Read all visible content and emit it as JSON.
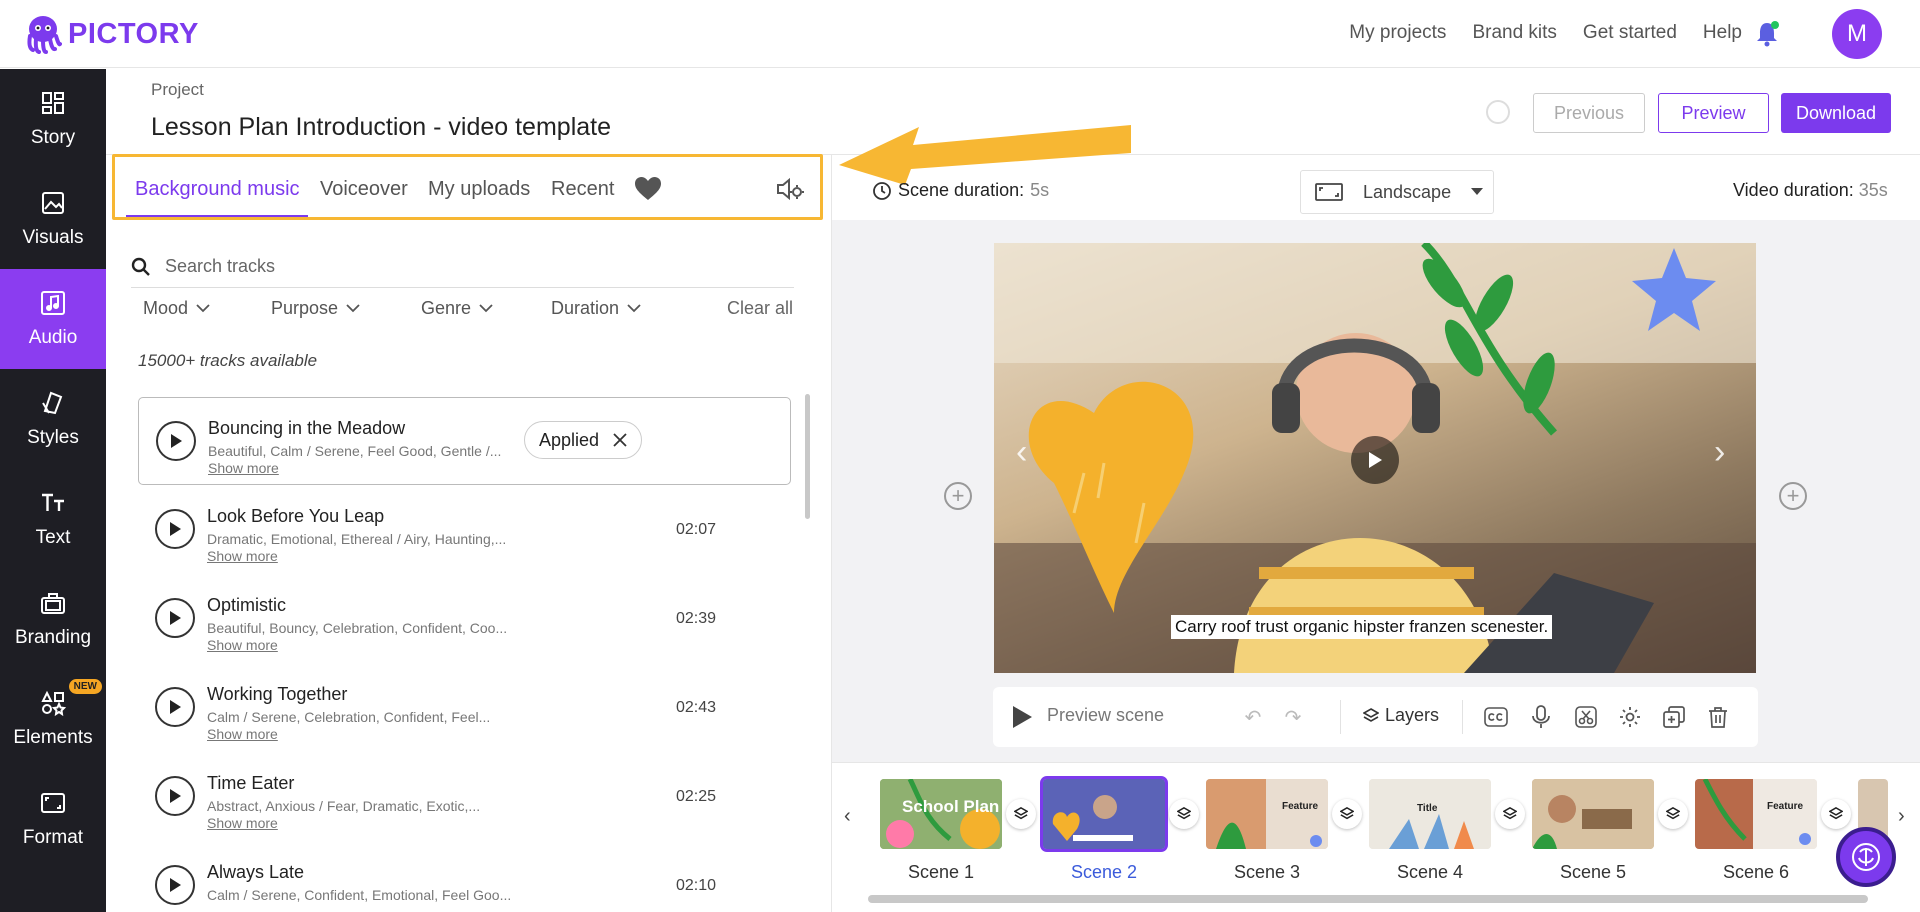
{
  "app": {
    "logo": "PICTORY",
    "avatar_initial": "M"
  },
  "topnav": [
    "My projects",
    "Brand kits",
    "Get started",
    "Help"
  ],
  "sidebar": [
    {
      "label": "Story",
      "icon": "grid-icon"
    },
    {
      "label": "Visuals",
      "icon": "image-icon"
    },
    {
      "label": "Audio",
      "icon": "music-note-icon",
      "active": true
    },
    {
      "label": "Styles",
      "icon": "palette-icon"
    },
    {
      "label": "Text",
      "icon": "text-icon"
    },
    {
      "label": "Branding",
      "icon": "briefcase-icon"
    },
    {
      "label": "Elements",
      "icon": "elements-icon",
      "badge": "NEW"
    },
    {
      "label": "Format",
      "icon": "format-icon"
    }
  ],
  "project": {
    "label": "Project",
    "title": "Lesson Plan Introduction - video template"
  },
  "actions": {
    "previous": "Previous",
    "preview": "Preview",
    "download": "Download"
  },
  "audio_tabs": [
    "Background music",
    "Voiceover",
    "My uploads",
    "Recent"
  ],
  "search": {
    "placeholder": "Search tracks"
  },
  "filters": [
    "Mood",
    "Purpose",
    "Genre",
    "Duration"
  ],
  "clear_all": "Clear all",
  "tracks_count": "15000+ tracks available",
  "show_more": "Show more",
  "applied_label": "Applied",
  "tracks": [
    {
      "name": "Bouncing in the Meadow",
      "tags": "Beautiful, Calm / Serene, Feel Good, Gentle /...",
      "duration": "",
      "applied": true
    },
    {
      "name": "Look Before You Leap",
      "tags": "Dramatic, Emotional, Ethereal / Airy, Haunting,...",
      "duration": "02:07"
    },
    {
      "name": "Optimistic",
      "tags": "Beautiful, Bouncy, Celebration, Confident, Coo...",
      "duration": "02:39"
    },
    {
      "name": "Working Together",
      "tags": "Calm / Serene, Celebration, Confident, Feel...",
      "duration": "02:43"
    },
    {
      "name": "Time Eater",
      "tags": "Abstract, Anxious / Fear, Dramatic, Exotic,...",
      "duration": "02:25"
    },
    {
      "name": "Always Late",
      "tags": "Calm / Serene, Confident, Emotional, Feel Goo...",
      "duration": "02:10"
    }
  ],
  "scene_info": {
    "scene_duration_label": "Scene duration:",
    "scene_duration": "5s",
    "orientation": "Landscape",
    "video_duration_label": "Video duration:",
    "video_duration": "35s"
  },
  "canvas": {
    "caption": "Carry roof trust organic hipster franzen scenester."
  },
  "scene_toolbar": {
    "preview_scene": "Preview scene",
    "layers": "Layers"
  },
  "scenes": [
    {
      "label": "Scene 1",
      "thumb_text": "School Plan",
      "color": "#7a9a5a"
    },
    {
      "label": "Scene 2",
      "thumb_text": "",
      "color": "#5b63b7",
      "active": true
    },
    {
      "label": "Scene 3",
      "thumb_text": "Feature",
      "color": "#d9c9b8"
    },
    {
      "label": "Scene 4",
      "thumb_text": "Title",
      "color": "#e8e4dc"
    },
    {
      "label": "Scene 5",
      "thumb_text": "",
      "color": "#c9a97f"
    },
    {
      "label": "Scene 6",
      "thumb_text": "Feature",
      "color": "#e6dfd6"
    }
  ],
  "colors": {
    "accent": "#7c3aed",
    "highlight": "#f7b733",
    "sidebar_bg": "#1e1e24"
  }
}
